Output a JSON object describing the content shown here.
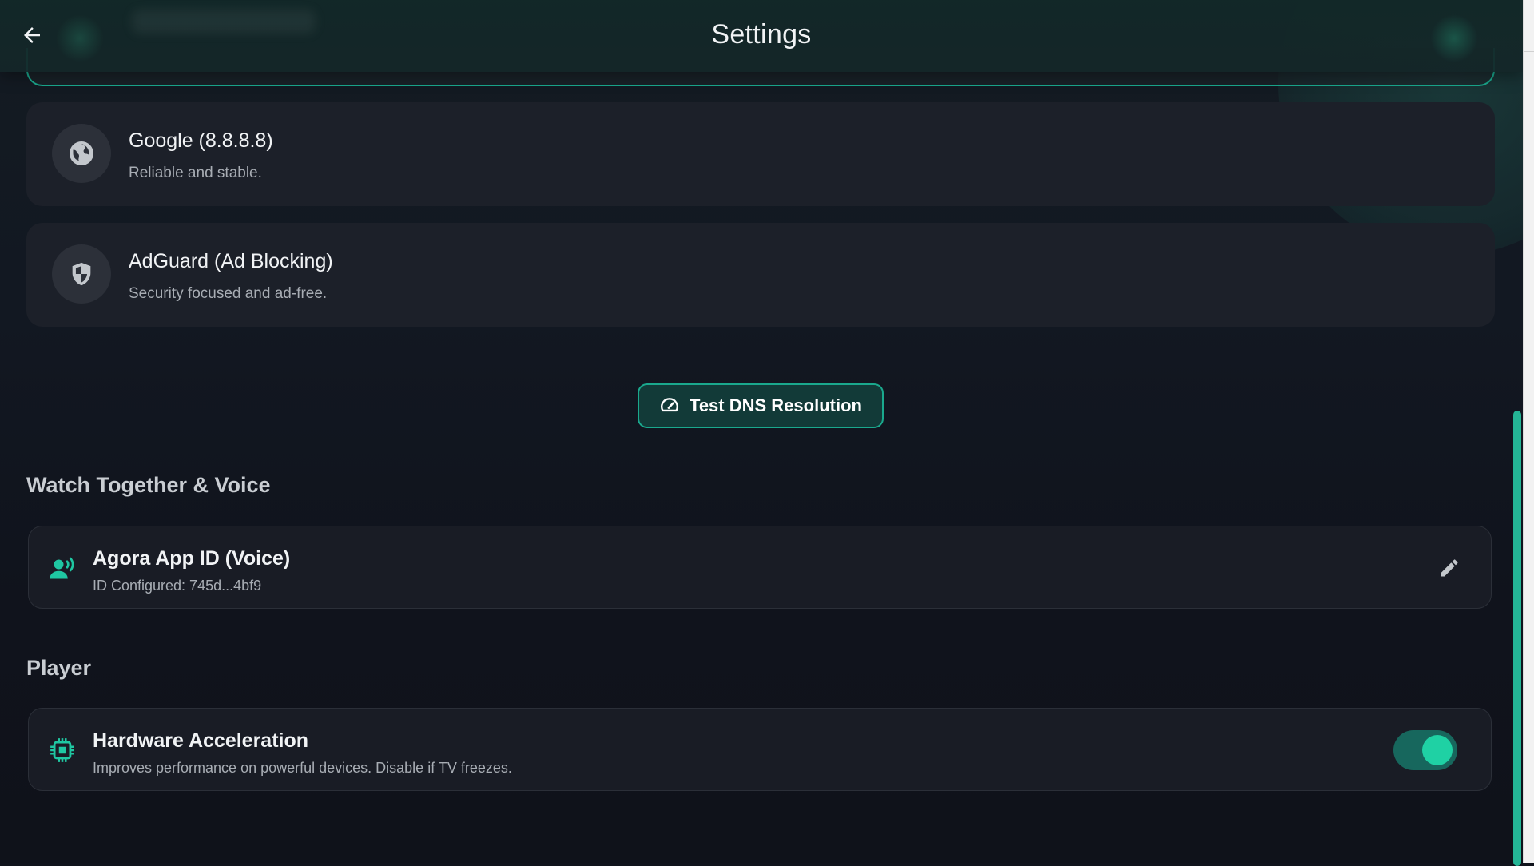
{
  "header": {
    "title": "Settings",
    "back_icon": "arrow-left-icon"
  },
  "dns": {
    "options": [
      {
        "title": "Google (8.8.8.8)",
        "subtitle": "Reliable and stable.",
        "icon": "globe-icon"
      },
      {
        "title": "AdGuard (Ad Blocking)",
        "subtitle": "Security focused and ad-free.",
        "icon": "shield-icon"
      }
    ],
    "test_button": {
      "label": "Test DNS Resolution",
      "icon": "speedometer-icon"
    }
  },
  "sections": {
    "watch_together": {
      "title": "Watch Together & Voice",
      "agora": {
        "title": "Agora App ID (Voice)",
        "subtitle": "ID Configured: 745d...4bf9",
        "icon": "voice-user-icon",
        "edit_icon": "pencil-icon"
      }
    },
    "player": {
      "title": "Player",
      "hardware_acceleration": {
        "title": "Hardware Acceleration",
        "subtitle": "Improves performance on powerful devices. Disable if TV freezes.",
        "icon": "chip-icon",
        "enabled": true
      }
    }
  },
  "colors": {
    "accent": "#1aa88d",
    "toggle_knob": "#1fd1a4",
    "background": "#10131c",
    "card": "#1c2029"
  }
}
